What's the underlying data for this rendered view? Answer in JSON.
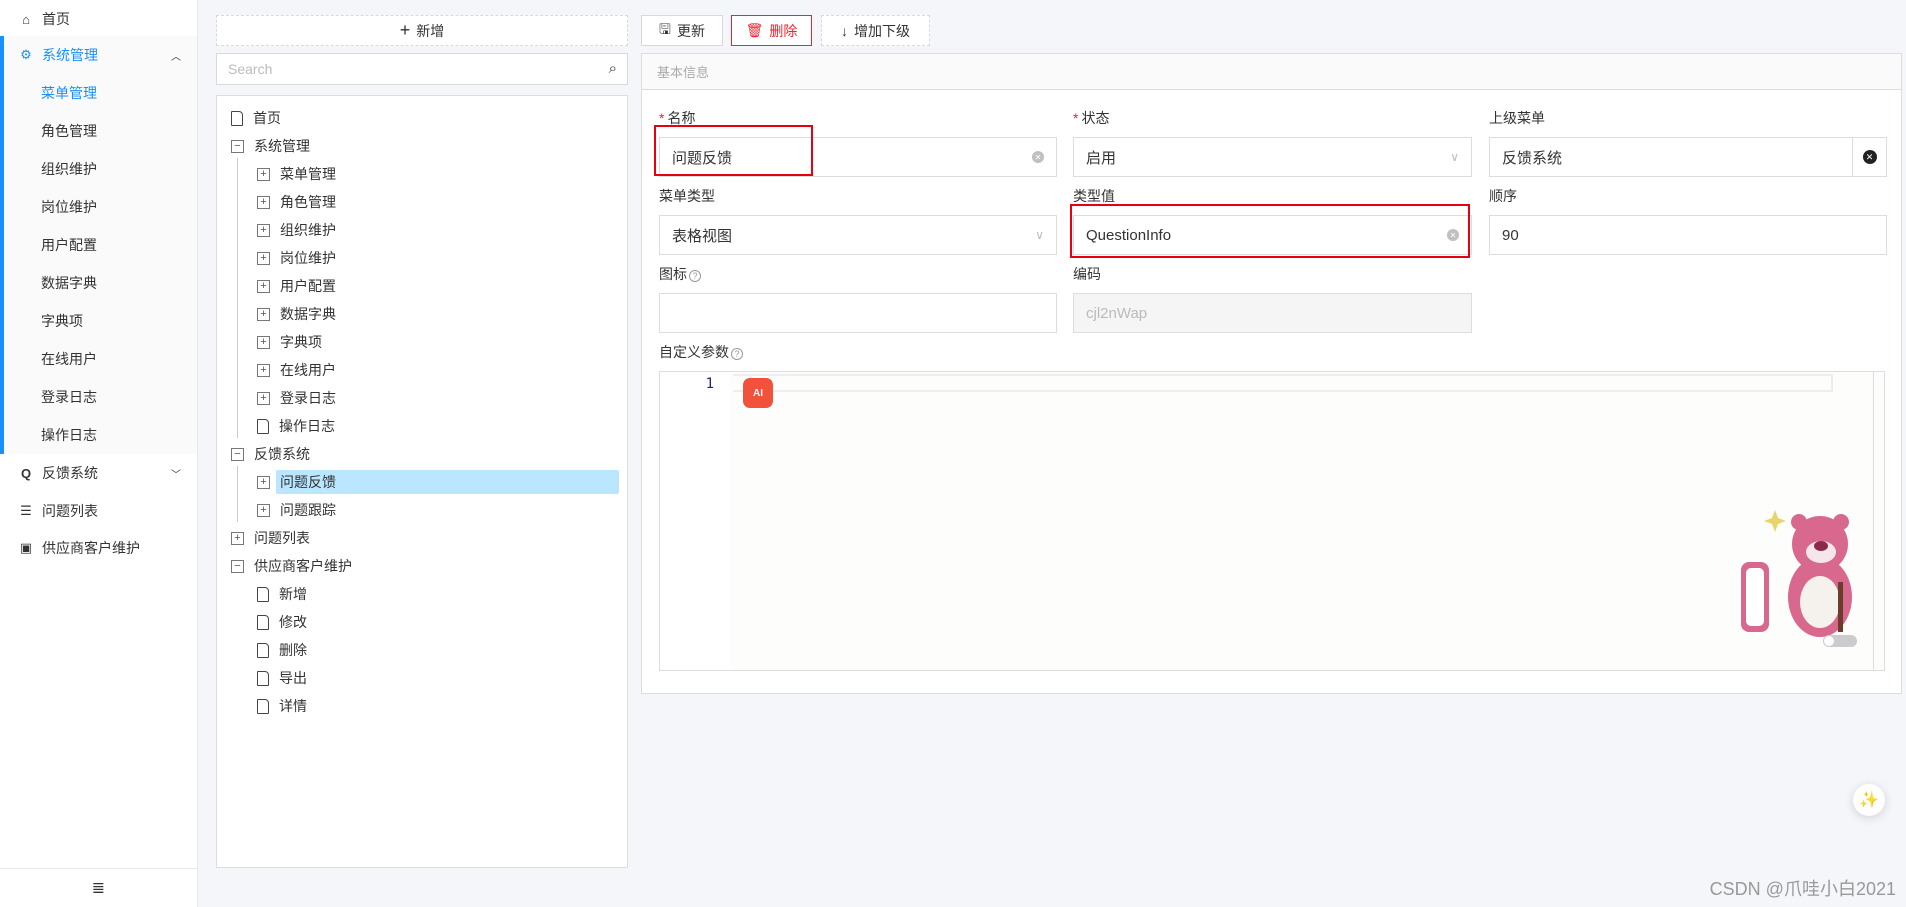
{
  "sidebar": {
    "items": [
      {
        "label": "首页",
        "icon": "home-icon",
        "glyph": "⌂"
      },
      {
        "label": "系统管理",
        "icon": "gears-icon",
        "glyph": "⚙",
        "expanded": true
      },
      {
        "label": "反馈系统",
        "icon": "q-icon",
        "glyph": "Q",
        "expanded": false
      },
      {
        "label": "问题列表",
        "icon": "list-icon",
        "glyph": "☰"
      },
      {
        "label": "供应商客户维护",
        "icon": "id-card-icon",
        "glyph": "▣"
      }
    ],
    "sub_items": [
      "菜单管理",
      "角色管理",
      "组织维护",
      "岗位维护",
      "用户配置",
      "数据字典",
      "字典项",
      "在线用户",
      "登录日志",
      "操作日志"
    ],
    "active_sub": "菜单管理",
    "collapse_icon": "≣"
  },
  "tree_panel": {
    "add_label": "新增",
    "search_placeholder": "Search",
    "nodes": [
      {
        "label": "首页",
        "level": 0,
        "type": "file"
      },
      {
        "label": "系统管理",
        "level": 0,
        "type": "minus"
      },
      {
        "label": "菜单管理",
        "level": 1,
        "type": "plus"
      },
      {
        "label": "角色管理",
        "level": 1,
        "type": "plus"
      },
      {
        "label": "组织维护",
        "level": 1,
        "type": "plus"
      },
      {
        "label": "岗位维护",
        "level": 1,
        "type": "plus"
      },
      {
        "label": "用户配置",
        "level": 1,
        "type": "plus"
      },
      {
        "label": "数据字典",
        "level": 1,
        "type": "plus"
      },
      {
        "label": "字典项",
        "level": 1,
        "type": "plus"
      },
      {
        "label": "在线用户",
        "level": 1,
        "type": "plus"
      },
      {
        "label": "登录日志",
        "level": 1,
        "type": "plus"
      },
      {
        "label": "操作日志",
        "level": 1,
        "type": "file"
      },
      {
        "label": "反馈系统",
        "level": 0,
        "type": "minus"
      },
      {
        "label": "问题反馈",
        "level": 1,
        "type": "plus",
        "selected": true
      },
      {
        "label": "问题跟踪",
        "level": 1,
        "type": "plus"
      },
      {
        "label": "问题列表",
        "level": 0,
        "type": "plus"
      },
      {
        "label": "供应商客户维护",
        "level": 0,
        "type": "minus"
      },
      {
        "label": "新增",
        "level": 1,
        "type": "file"
      },
      {
        "label": "修改",
        "level": 1,
        "type": "file"
      },
      {
        "label": "删除",
        "level": 1,
        "type": "file"
      },
      {
        "label": "导出",
        "level": 1,
        "type": "file"
      },
      {
        "label": "详情",
        "level": 1,
        "type": "file"
      }
    ]
  },
  "toolbar": {
    "update_label": "更新",
    "delete_label": "删除",
    "add_child_label": "增加下级",
    "delete_color": "#f5222d"
  },
  "form": {
    "section_title": "基本信息",
    "name": {
      "label": "名称",
      "value": "问题反馈",
      "required": true
    },
    "status": {
      "label": "状态",
      "value": "启用",
      "required": true
    },
    "parent": {
      "label": "上级菜单",
      "value": "反馈系统"
    },
    "menu_type": {
      "label": "菜单类型",
      "value": "表格视图"
    },
    "type_value": {
      "label": "类型值",
      "value": "QuestionInfo"
    },
    "order": {
      "label": "顺序",
      "value": "90"
    },
    "icon": {
      "label": "图标",
      "value": ""
    },
    "code": {
      "label": "编码",
      "value": "cjl2nWap"
    },
    "params": {
      "label": "自定义参数",
      "line_number": "1"
    }
  },
  "overlays": {
    "ai_badge": "AI",
    "watermark": "CSDN @爪哇小白2021",
    "highlight_color": "#e60012"
  }
}
